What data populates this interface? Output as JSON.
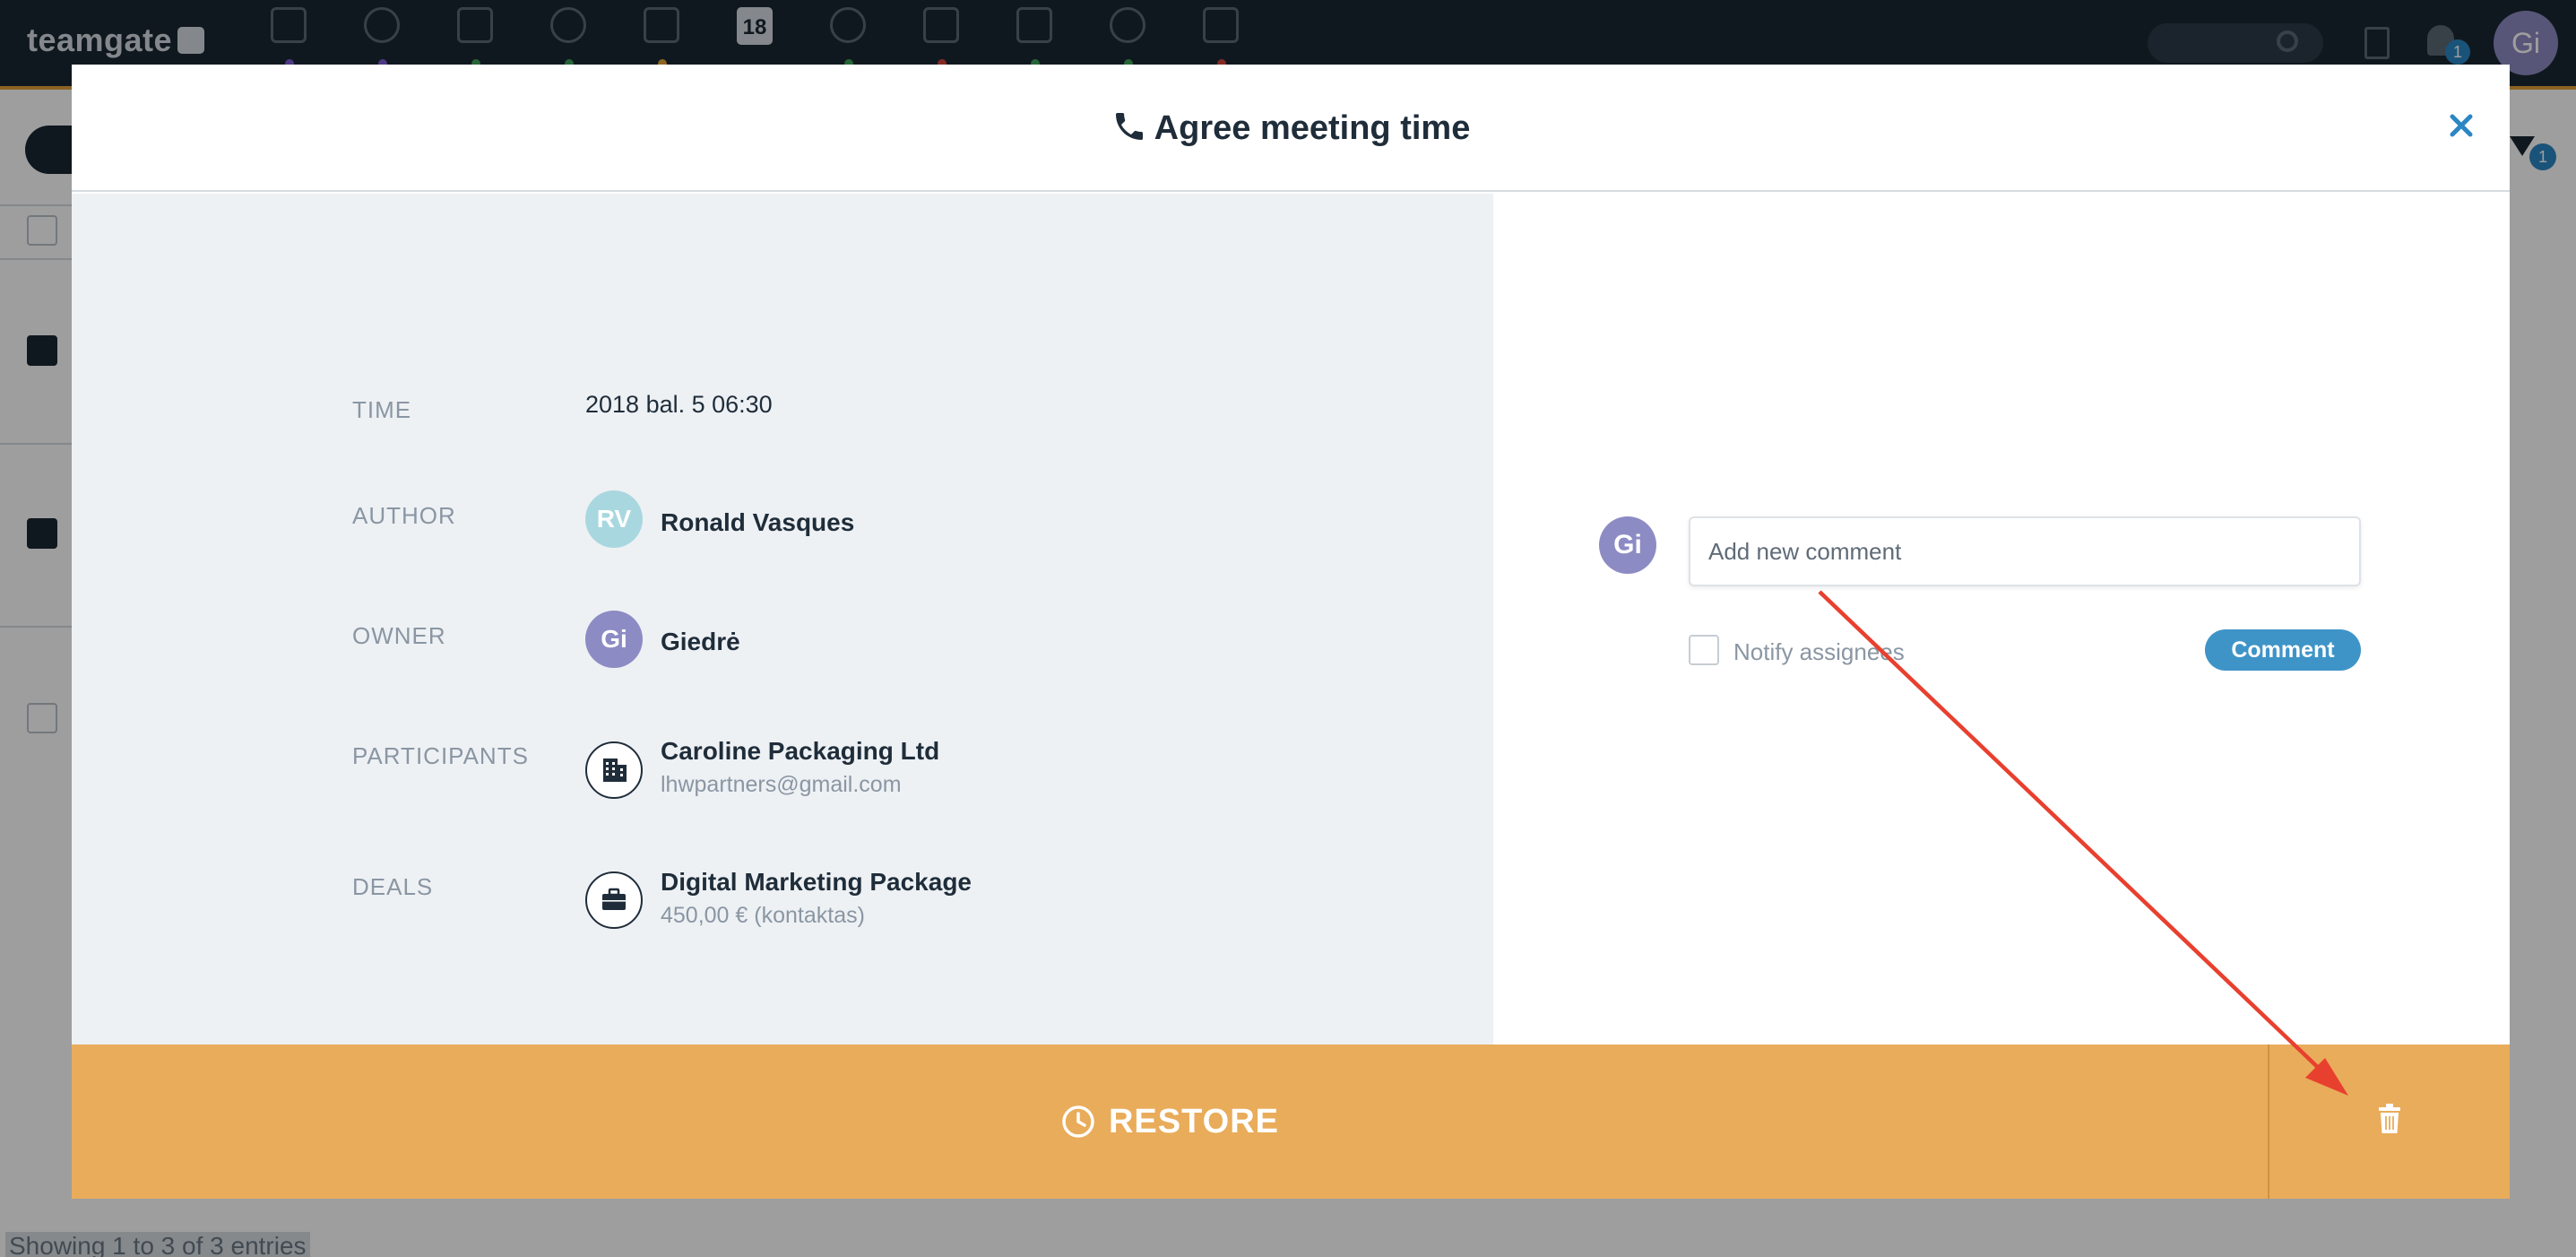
{
  "app": {
    "logo_text": "teamgate",
    "calendar_day": "18",
    "notifications_count": "1",
    "user_initials": "Gi",
    "filter_count": "1",
    "entries_text": "Showing 1 to 3 of 3 entries"
  },
  "modal": {
    "title": "Agree meeting time",
    "title_icon": "phone-icon",
    "close_icon": "close-icon"
  },
  "details": {
    "time_label": "TIME",
    "time_value": "2018 bal. 5 06:30",
    "author_label": "AUTHOR",
    "author_initials": "RV",
    "author_name": "Ronald Vasques",
    "owner_label": "OWNER",
    "owner_initials": "Gi",
    "owner_name": "Giedrė",
    "participants_label": "PARTICIPANTS",
    "participant_name": "Caroline Packaging Ltd",
    "participant_email": "lhwpartners@gmail.com",
    "deals_label": "DEALS",
    "deal_name": "Digital Marketing Package",
    "deal_value": "450,00 € (kontaktas)"
  },
  "comments": {
    "avatar_initials": "Gi",
    "placeholder": "Add new comment",
    "notify_label": "Notify assignees",
    "button_label": "Comment"
  },
  "footer": {
    "restore_label": "RESTORE",
    "restore_icon": "clock-icon",
    "delete_icon": "trash-icon"
  },
  "colors": {
    "topbar": "#1b2733",
    "accent_orange": "#e9ac5a",
    "comment_button": "#3f94c7",
    "close_blue": "#2b86c4",
    "author_avatar": "#a9d7e0",
    "owner_avatar": "#8d8bc4",
    "annotation_arrow": "#e8402f"
  }
}
